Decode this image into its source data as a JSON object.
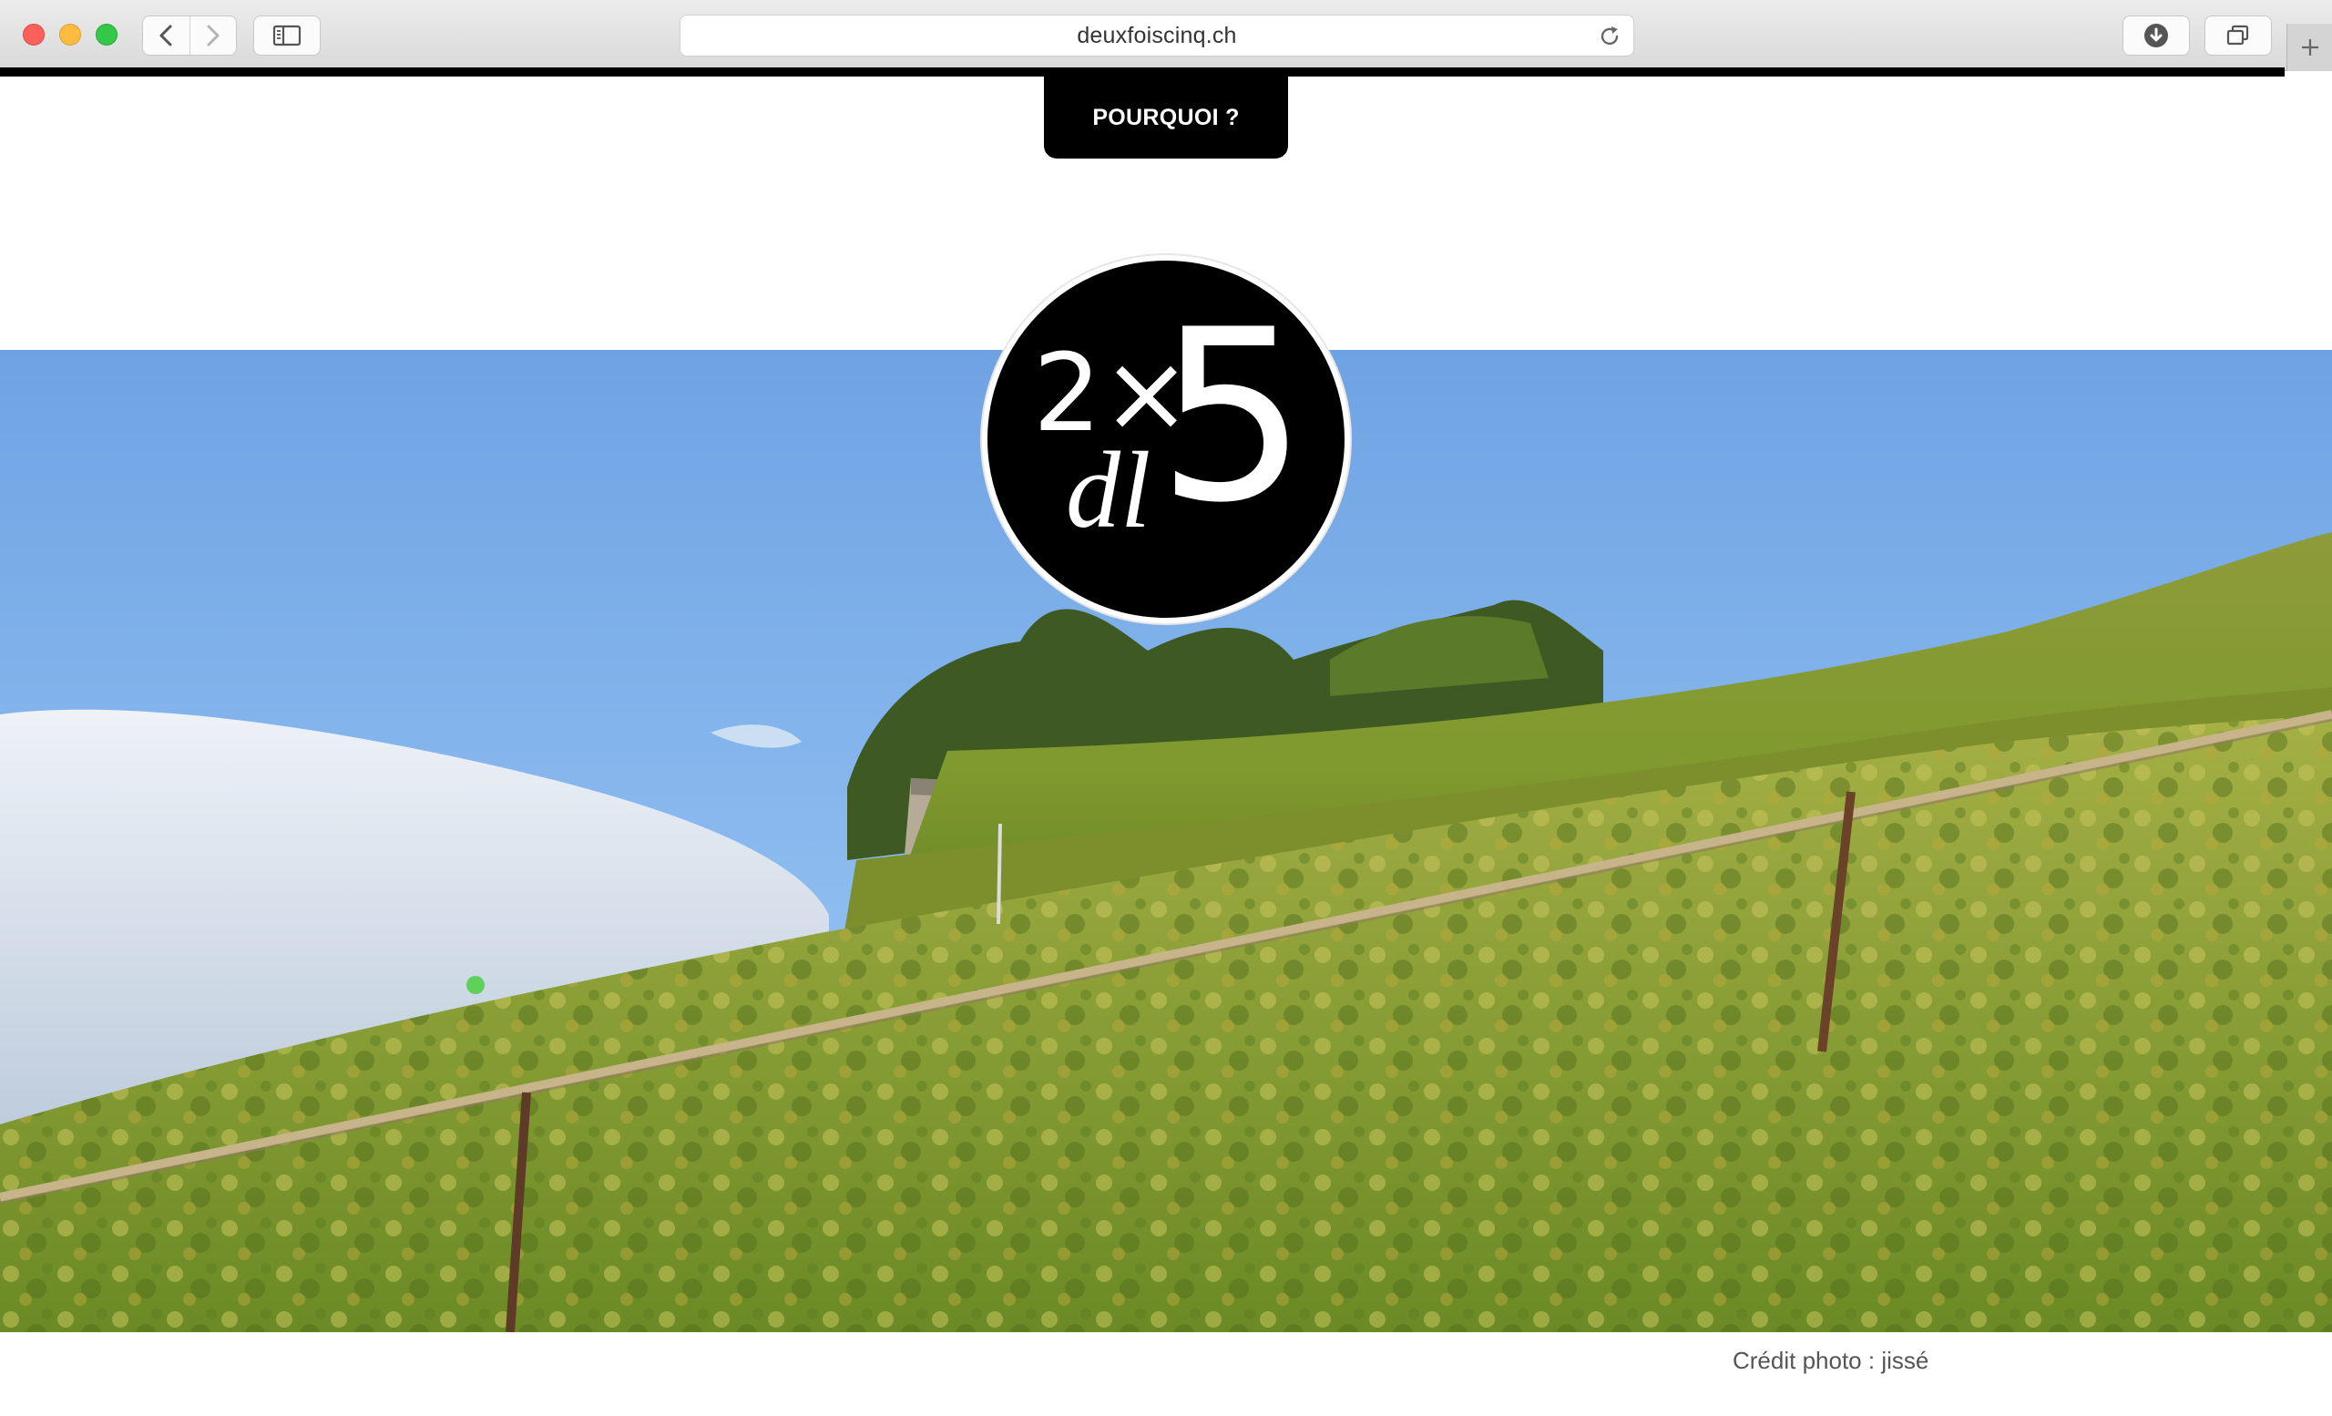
{
  "browser": {
    "url": "deuxfoiscinq.ch",
    "icons": {
      "back": "chevron-left-icon",
      "forward": "chevron-right-icon",
      "sidebar": "sidebar-icon",
      "reload": "reload-icon",
      "download": "download-icon",
      "tabs": "tabs-overview-icon",
      "new_tab": "plus-icon"
    }
  },
  "nav": {
    "menu_label": "POURQUOI ?"
  },
  "logo": {
    "two_times": "2×",
    "dl": "dl",
    "five": "5"
  },
  "hero": {
    "credit": "Crédit photo : jissé"
  }
}
